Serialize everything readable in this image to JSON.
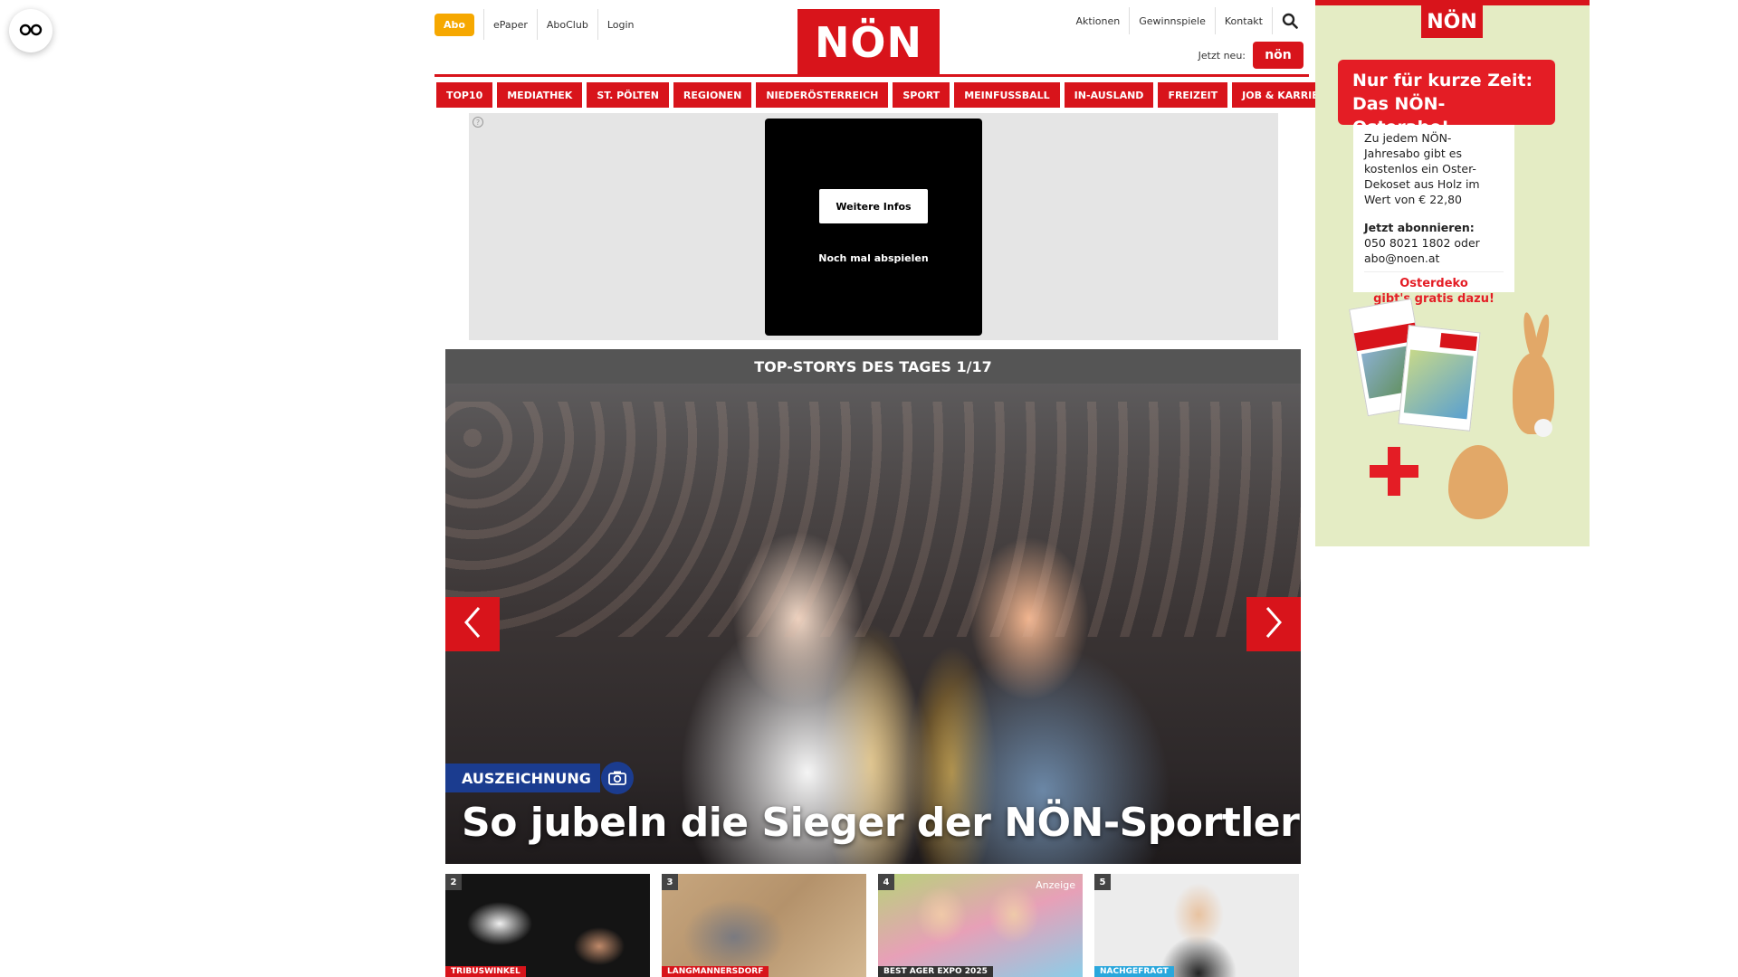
{
  "header": {
    "abo_label": "Abo",
    "links_left": [
      "ePaper",
      "AboClub",
      "Login"
    ],
    "logo_text": "NÖN",
    "links_right": [
      "Aktionen",
      "Gewinnspiele",
      "Kontakt"
    ],
    "jetzt_neu_label": "Jetzt neu:",
    "mini_logo_text": "nön"
  },
  "nav": {
    "items": [
      "TOP10",
      "MEDIATHEK",
      "ST. PÖLTEN",
      "REGIONEN",
      "NIEDERÖSTERREICH",
      "SPORT",
      "MEINFUSSBALL",
      "IN-AUSLAND",
      "FREIZEIT",
      "JOB & KARRIERE"
    ]
  },
  "ad_video": {
    "more_label": "Weitere Infos",
    "replay_label": "Noch mal abspielen"
  },
  "top_stories": {
    "title": "TOP-STORYS DES TAGES 1/17",
    "category": "AUSZEICHNUNG",
    "headline": "So jubeln die Sieger der NÖN-Sportlerwahl"
  },
  "teasers": [
    {
      "num": "2",
      "tag": "TRIBUSWINKEL",
      "tag_color": "#d8141b",
      "sponsored": ""
    },
    {
      "num": "3",
      "tag": "LANGMANNERSDORF",
      "tag_color": "#d8141b",
      "sponsored": ""
    },
    {
      "num": "4",
      "tag": "BEST AGER EXPO 2025",
      "tag_color": "#333333",
      "sponsored": "Anzeige"
    },
    {
      "num": "5",
      "tag": "NACHGEFRAGT",
      "tag_color": "#2aa7dc",
      "sponsored": ""
    }
  ],
  "right_ad": {
    "logo_text": "NÖN",
    "promo_line1": "Nur für kurze Zeit:",
    "promo_line2": "Das NÖN-Osterabo!",
    "body": "Zu jedem NÖN-Jahresabo gibt es kostenlos ein Oster-Dekoset aus Holz im Wert von € 22,80",
    "subscribe_label": "Jetzt abonnieren:",
    "phone": "050 8021 1802 oder",
    "email": "abo@noen.at",
    "cta_line1": "Osterdeko",
    "cta_line2": "gibt's gratis dazu!"
  },
  "colors": {
    "brand_red": "#d8141b",
    "abo_orange": "#f6a800",
    "category_blue": "#1b3c8f"
  }
}
